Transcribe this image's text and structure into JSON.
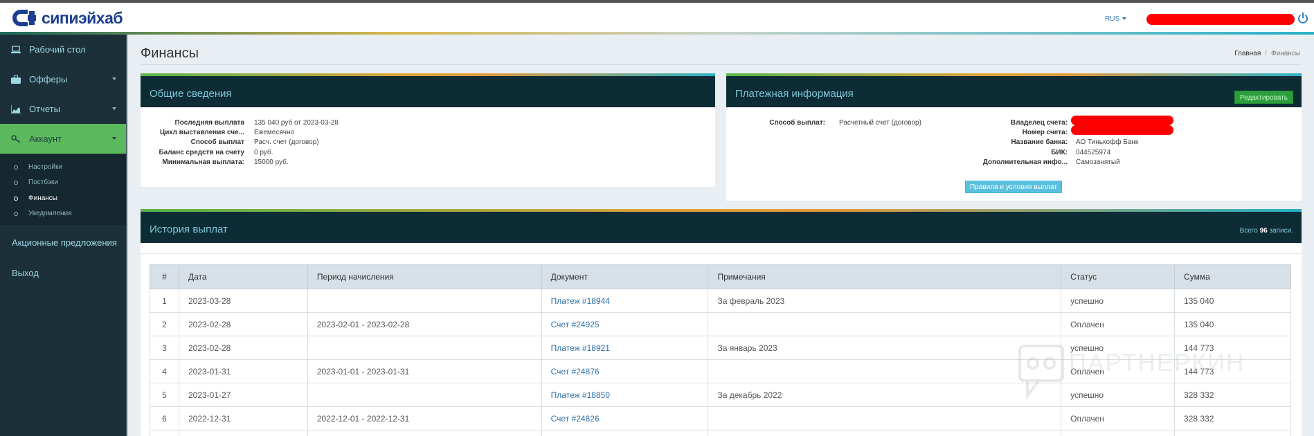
{
  "brand": {
    "name": "сипиэйхаб",
    "logo_color": "#1b3e8e"
  },
  "header": {
    "language": "RUS"
  },
  "sidebar": {
    "items": [
      {
        "label": "Рабочий стол",
        "icon": "laptop-icon"
      },
      {
        "label": "Офферы",
        "icon": "briefcase-icon"
      },
      {
        "label": "Отчеты",
        "icon": "chart-icon"
      },
      {
        "label": "Аккаунт",
        "icon": "key-icon",
        "active": true
      }
    ],
    "account_submenu": [
      {
        "label": "Настройки"
      },
      {
        "label": "Постбэки"
      },
      {
        "label": "Финансы",
        "current": true
      },
      {
        "label": "Уведомления"
      }
    ],
    "promo": "Акционные предложения",
    "logout": "Выход"
  },
  "page": {
    "title": "Финансы",
    "breadcrumb": {
      "home": "Главная",
      "current": "Финансы"
    }
  },
  "general": {
    "title": "Общие сведения",
    "rows": [
      {
        "label": "Последняя выплата",
        "value": "135 040 руб от 2023-03-28"
      },
      {
        "label": "Цикл выставления сче...",
        "value": "Ежемесячно"
      },
      {
        "label": "Способ выплат",
        "value": "Расч. счет (договор)"
      },
      {
        "label": "Баланс средств на счету",
        "value": "0 руб."
      },
      {
        "label": "Минимальная выплата:",
        "value": "15000 руб."
      }
    ]
  },
  "payment": {
    "title": "Платежная информация",
    "edit_label": "Редактировать",
    "method_label": "Способ выплат:",
    "method_value": "Расчетный счет (договор)",
    "rows": [
      {
        "label": "Владелец счета:",
        "value": ""
      },
      {
        "label": "Номер счета:",
        "value": ""
      },
      {
        "label": "Название банка:",
        "value": "АО Тинькофф Банк"
      },
      {
        "label": "БИК:",
        "value": "044525974"
      },
      {
        "label": "Дополнительная инфо...",
        "value": "Самозанятый"
      }
    ],
    "rules_label": "Правила и условия выплат"
  },
  "history": {
    "title": "История выплат",
    "total_prefix": "Всего",
    "total_count": "96",
    "total_suffix": "записи.",
    "columns": [
      "#",
      "Дата",
      "Период начисления",
      "Документ",
      "Примечания",
      "Статус",
      "Сумма"
    ],
    "rows": [
      {
        "n": "1",
        "date": "2023-03-28",
        "period": "",
        "doc": "Платеж #18944",
        "note": "За февраль 2023",
        "status": "успешно",
        "sum": "135 040"
      },
      {
        "n": "2",
        "date": "2023-02-28",
        "period": "2023-02-01 - 2023-02-28",
        "doc": "Счет #24925",
        "note": "",
        "status": "Оплачен",
        "sum": "135 040"
      },
      {
        "n": "3",
        "date": "2023-02-28",
        "period": "",
        "doc": "Платеж #18921",
        "note": "За январь 2023",
        "status": "успешно",
        "sum": "144 773"
      },
      {
        "n": "4",
        "date": "2023-01-31",
        "period": "2023-01-01 - 2023-01-31",
        "doc": "Счет #24876",
        "note": "",
        "status": "Оплачен",
        "sum": "144 773"
      },
      {
        "n": "5",
        "date": "2023-01-27",
        "period": "",
        "doc": "Платеж #18850",
        "note": "За декабрь 2022",
        "status": "успешно",
        "sum": "328 332"
      },
      {
        "n": "6",
        "date": "2022-12-31",
        "period": "2022-12-01 - 2022-12-31",
        "doc": "Счет #24826",
        "note": "",
        "status": "Оплачен",
        "sum": "328 332"
      },
      {
        "n": "",
        "date": "",
        "period": "",
        "doc": "",
        "note": "",
        "status": "",
        "sum": ""
      }
    ]
  },
  "watermark": "ПАРТНЕРКИН"
}
